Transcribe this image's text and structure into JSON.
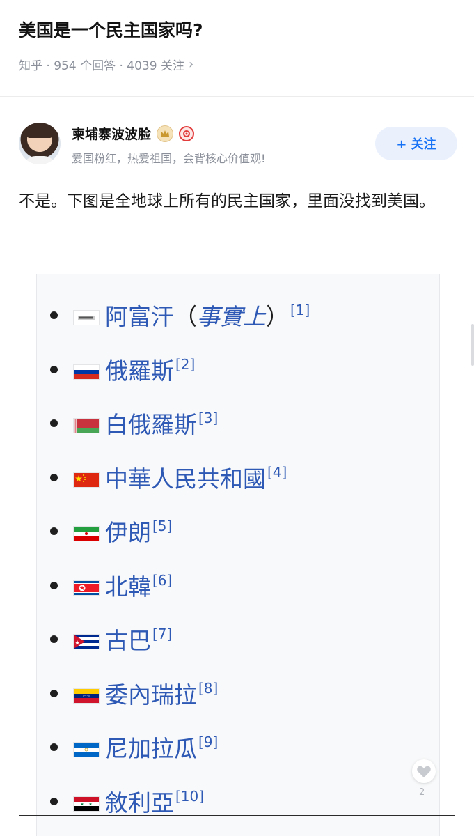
{
  "question": {
    "title": "美国是一个民主国家吗?",
    "meta": "知乎 · 954 个回答 · 4039 关注",
    "chevron": "›"
  },
  "author": {
    "name": "柬埔寨波波脸",
    "bio": "爱国粉红，热爱祖国，会背核心价值观!",
    "follow_label": "+ 关注",
    "badges": [
      "crown-icon",
      "red-badge-icon"
    ]
  },
  "answer": {
    "text": "不是。下图是全地球上所有的民主国家，里面没找到美国。"
  },
  "embed": {
    "countries": [
      {
        "name": "阿富汗",
        "paren_open": "（",
        "note": "事實上",
        "paren_close": "）",
        "ref": "[1]",
        "flag": "afghanistan-flag-icon"
      },
      {
        "name": "俄羅斯",
        "ref": "[2]",
        "flag": "russia-flag-icon"
      },
      {
        "name": "白俄羅斯",
        "ref": "[3]",
        "flag": "belarus-flag-icon"
      },
      {
        "name": "中華人民共和國",
        "ref": "[4]",
        "flag": "china-flag-icon"
      },
      {
        "name": "伊朗",
        "ref": "[5]",
        "flag": "iran-flag-icon"
      },
      {
        "name": "北韓",
        "ref": "[6]",
        "flag": "north-korea-flag-icon"
      },
      {
        "name": "古巴",
        "ref": "[7]",
        "flag": "cuba-flag-icon"
      },
      {
        "name": "委內瑞拉",
        "ref": "[8]",
        "flag": "venezuela-flag-icon"
      },
      {
        "name": "尼加拉瓜",
        "ref": "[9]",
        "flag": "nicaragua-flag-icon"
      },
      {
        "name": "敘利亞",
        "ref": "[10]",
        "flag": "syria-flag-icon"
      }
    ]
  },
  "actions": {
    "like_count": "2",
    "like_icon": "heart-icon"
  },
  "colors": {
    "link": "#2e59b5",
    "follow": "#1772f6",
    "meta": "#8a8f99"
  }
}
